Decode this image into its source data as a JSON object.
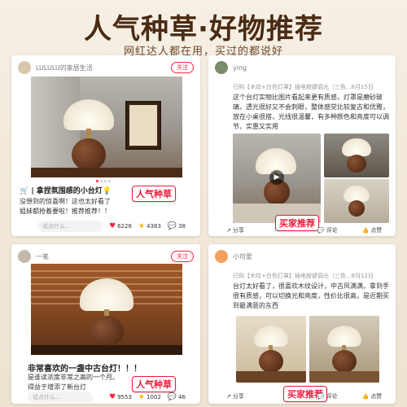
{
  "hero": {
    "title": "人气种草·好物推荐",
    "subtitle": "网红达人都在用，买过的都说好"
  },
  "card1": {
    "username": "LULULU的家居生活",
    "follow_label": "关注",
    "title": "🛒 | 拿捏氛围感的小台灯💡",
    "body_line1": "没想到的惊喜啊！这也太好看了",
    "body_line2": "姐妹都抢着要啦！推荐推荐！！",
    "tag": "人气种草",
    "comment_placeholder": "说点什么...",
    "likes": "6226",
    "favorites": "4383",
    "comments": "38"
  },
  "card2": {
    "username": "ying",
    "meta": "已购【木纹+白色灯罩】插电按键调光（三色...8月15日",
    "body": "这个台灯实物比图片看起来更有质感，灯罩是磨砂玻璃，透光很好又不会刺眼，整体感觉比较复古和优雅，放在小桌很搭，光线很温馨，有多种颜色和亮度可以调节，实惠又实用",
    "tag": "买家推荐",
    "share_label": "分享",
    "comment_label": "评论",
    "like_label": "点赞"
  },
  "card3": {
    "username": "一笔",
    "follow_label": "关注",
    "title": "非常喜欢的一盏中古台灯！！！",
    "body_line1": "是谁读浓度非常之高的一个月。",
    "body_line2": "得益于增添了新台灯",
    "tag": "人气种草",
    "comment_placeholder": "说点什么...",
    "likes": "9553",
    "favorites": "1002",
    "comments": "46"
  },
  "card4": {
    "username": "小可爱",
    "meta": "已购【木纹+白色灯罩】插电按键调光（三色...8月12日",
    "body": "台灯太好看了，很喜欢木纹设计，中古风满满，拿到手很有质感，可以切换光和亮度，性价比很高，是近期买到最满意的东西",
    "tag": "买家推荐",
    "share_label": "分享",
    "comment_label": "评论",
    "like_label": "点赞"
  },
  "colors": {
    "accent": "#ff2442",
    "title": "#4a2a12"
  },
  "icons": {
    "heart": "heart-icon",
    "star": "star-icon",
    "comment": "comment-icon",
    "share": "share-icon",
    "play": "play-icon"
  }
}
